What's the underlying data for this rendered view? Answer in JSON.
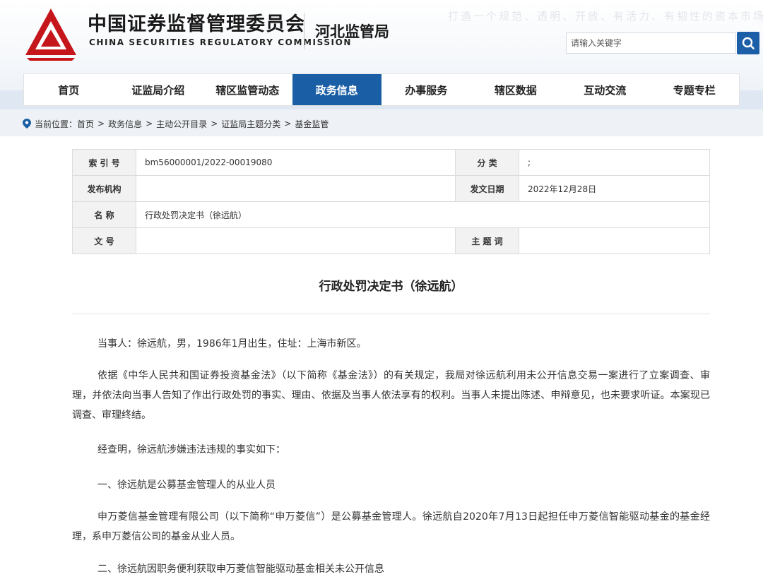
{
  "header": {
    "title_cn": "中国证券监督管理委员会",
    "title_en": "CHINA SECURITIES REGULATORY COMMISSION",
    "sub_title": "河北监管局",
    "slogan": "打造一个规范、透明、开放、有活力、有韧性的资本市场",
    "search_placeholder": "请输入关键字",
    "brand_color": "#c5161c",
    "accent_color": "#1a5fa6"
  },
  "nav": {
    "items": [
      "首页",
      "证监局介绍",
      "辖区监管动态",
      "政务信息",
      "办事服务",
      "辖区数据",
      "互动交流",
      "专题专栏"
    ],
    "active": "政务信息"
  },
  "breadcrumb": {
    "prefix": "当前位置：",
    "items": [
      "首页",
      "政务信息",
      "主动公开目录",
      "证监局主题分类",
      "基金监管"
    ]
  },
  "meta": {
    "index_no_label": "索 引 号",
    "index_no": "bm56000001/2022-00019080",
    "category_label": "分 类",
    "category": ";",
    "publisher_label": "发布机构",
    "publisher": "",
    "date_label": "发文日期",
    "date": "2022年12月28日",
    "name_label": "名 称",
    "name": "行政处罚决定书（徐远航）",
    "doc_no_label": "文 号",
    "doc_no": "",
    "keywords_label": "主 题 词",
    "keywords": ""
  },
  "document": {
    "title": "行政处罚决定书（徐远航）",
    "paragraphs": [
      "当事人：徐远航，男，1986年1月出生，住址：上海市新区。",
      "依据《中华人民共和国证券投资基金法》（以下简称《基金法》）的有关规定，我局对徐远航利用未公开信息交易一案进行了立案调查、审理，并依法向当事人告知了作出行政处罚的事实、理由、依据及当事人依法享有的权利。当事人未提出陈述、申辩意见，也未要求听证。本案现已调查、审理终结。",
      "经查明，徐远航涉嫌违法违规的事实如下：",
      "一、徐远航是公募基金管理人的从业人员",
      "申万菱信基金管理有限公司（以下简称“申万菱信”）是公募基金管理人。徐远航自2020年7月13日起担任申万菱信智能驱动基金的基金经理，系申万菱信公司的基金从业人员。",
      "二、徐远航因职务便利获取申万菱信智能驱动基金相关未公开信息"
    ]
  }
}
